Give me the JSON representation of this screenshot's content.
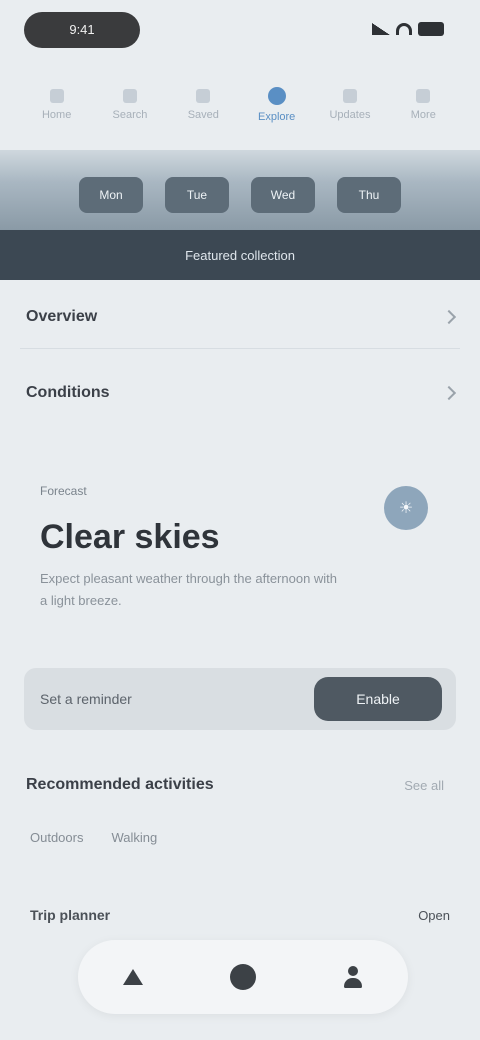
{
  "status": {
    "time": "9:41"
  },
  "top_tabs": [
    {
      "label": "Home"
    },
    {
      "label": "Search"
    },
    {
      "label": "Saved"
    },
    {
      "label": "Explore"
    },
    {
      "label": "Updates"
    },
    {
      "label": "More"
    }
  ],
  "band": {
    "chips": [
      "Mon",
      "Tue",
      "Wed",
      "Thu"
    ]
  },
  "banner": {
    "text": "Featured collection"
  },
  "rows": [
    {
      "title": "Overview"
    },
    {
      "title": "Conditions"
    }
  ],
  "card": {
    "kicker": "Forecast",
    "headline": "Clear skies",
    "description": "Expect pleasant weather through the afternoon with a light breeze.",
    "badge_icon": "weather-icon"
  },
  "action": {
    "placeholder": "Set a reminder",
    "button": "Enable"
  },
  "section": {
    "title": "Recommended activities",
    "more": "See all"
  },
  "tags": [
    "Outdoors",
    "Walking"
  ],
  "footer_row": {
    "left": "Trip planner",
    "right": "Open"
  },
  "colors": {
    "accent": "#5a8fc4",
    "dark": "#3c4853",
    "button": "#4f5962"
  }
}
